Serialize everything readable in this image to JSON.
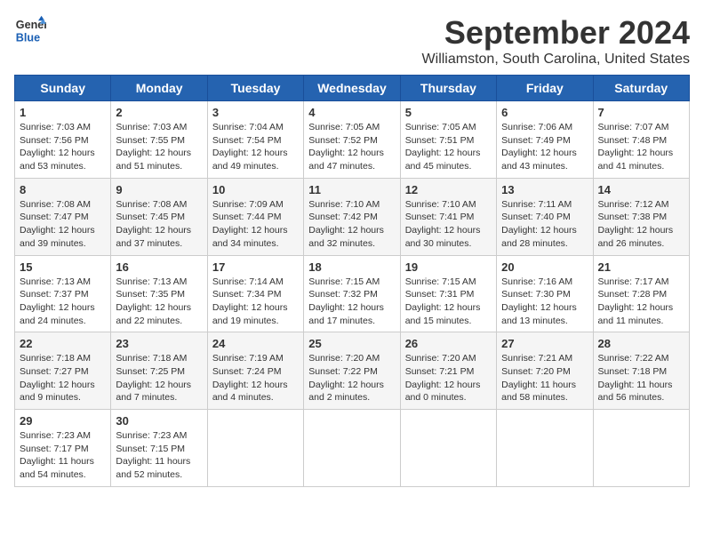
{
  "logo": {
    "line1": "General",
    "line2": "Blue"
  },
  "title": "September 2024",
  "location": "Williamston, South Carolina, United States",
  "weekdays": [
    "Sunday",
    "Monday",
    "Tuesday",
    "Wednesday",
    "Thursday",
    "Friday",
    "Saturday"
  ],
  "weeks": [
    [
      {
        "day": "1",
        "sunrise": "Sunrise: 7:03 AM",
        "sunset": "Sunset: 7:56 PM",
        "daylight": "Daylight: 12 hours and 53 minutes."
      },
      {
        "day": "2",
        "sunrise": "Sunrise: 7:03 AM",
        "sunset": "Sunset: 7:55 PM",
        "daylight": "Daylight: 12 hours and 51 minutes."
      },
      {
        "day": "3",
        "sunrise": "Sunrise: 7:04 AM",
        "sunset": "Sunset: 7:54 PM",
        "daylight": "Daylight: 12 hours and 49 minutes."
      },
      {
        "day": "4",
        "sunrise": "Sunrise: 7:05 AM",
        "sunset": "Sunset: 7:52 PM",
        "daylight": "Daylight: 12 hours and 47 minutes."
      },
      {
        "day": "5",
        "sunrise": "Sunrise: 7:05 AM",
        "sunset": "Sunset: 7:51 PM",
        "daylight": "Daylight: 12 hours and 45 minutes."
      },
      {
        "day": "6",
        "sunrise": "Sunrise: 7:06 AM",
        "sunset": "Sunset: 7:49 PM",
        "daylight": "Daylight: 12 hours and 43 minutes."
      },
      {
        "day": "7",
        "sunrise": "Sunrise: 7:07 AM",
        "sunset": "Sunset: 7:48 PM",
        "daylight": "Daylight: 12 hours and 41 minutes."
      }
    ],
    [
      {
        "day": "8",
        "sunrise": "Sunrise: 7:08 AM",
        "sunset": "Sunset: 7:47 PM",
        "daylight": "Daylight: 12 hours and 39 minutes."
      },
      {
        "day": "9",
        "sunrise": "Sunrise: 7:08 AM",
        "sunset": "Sunset: 7:45 PM",
        "daylight": "Daylight: 12 hours and 37 minutes."
      },
      {
        "day": "10",
        "sunrise": "Sunrise: 7:09 AM",
        "sunset": "Sunset: 7:44 PM",
        "daylight": "Daylight: 12 hours and 34 minutes."
      },
      {
        "day": "11",
        "sunrise": "Sunrise: 7:10 AM",
        "sunset": "Sunset: 7:42 PM",
        "daylight": "Daylight: 12 hours and 32 minutes."
      },
      {
        "day": "12",
        "sunrise": "Sunrise: 7:10 AM",
        "sunset": "Sunset: 7:41 PM",
        "daylight": "Daylight: 12 hours and 30 minutes."
      },
      {
        "day": "13",
        "sunrise": "Sunrise: 7:11 AM",
        "sunset": "Sunset: 7:40 PM",
        "daylight": "Daylight: 12 hours and 28 minutes."
      },
      {
        "day": "14",
        "sunrise": "Sunrise: 7:12 AM",
        "sunset": "Sunset: 7:38 PM",
        "daylight": "Daylight: 12 hours and 26 minutes."
      }
    ],
    [
      {
        "day": "15",
        "sunrise": "Sunrise: 7:13 AM",
        "sunset": "Sunset: 7:37 PM",
        "daylight": "Daylight: 12 hours and 24 minutes."
      },
      {
        "day": "16",
        "sunrise": "Sunrise: 7:13 AM",
        "sunset": "Sunset: 7:35 PM",
        "daylight": "Daylight: 12 hours and 22 minutes."
      },
      {
        "day": "17",
        "sunrise": "Sunrise: 7:14 AM",
        "sunset": "Sunset: 7:34 PM",
        "daylight": "Daylight: 12 hours and 19 minutes."
      },
      {
        "day": "18",
        "sunrise": "Sunrise: 7:15 AM",
        "sunset": "Sunset: 7:32 PM",
        "daylight": "Daylight: 12 hours and 17 minutes."
      },
      {
        "day": "19",
        "sunrise": "Sunrise: 7:15 AM",
        "sunset": "Sunset: 7:31 PM",
        "daylight": "Daylight: 12 hours and 15 minutes."
      },
      {
        "day": "20",
        "sunrise": "Sunrise: 7:16 AM",
        "sunset": "Sunset: 7:30 PM",
        "daylight": "Daylight: 12 hours and 13 minutes."
      },
      {
        "day": "21",
        "sunrise": "Sunrise: 7:17 AM",
        "sunset": "Sunset: 7:28 PM",
        "daylight": "Daylight: 12 hours and 11 minutes."
      }
    ],
    [
      {
        "day": "22",
        "sunrise": "Sunrise: 7:18 AM",
        "sunset": "Sunset: 7:27 PM",
        "daylight": "Daylight: 12 hours and 9 minutes."
      },
      {
        "day": "23",
        "sunrise": "Sunrise: 7:18 AM",
        "sunset": "Sunset: 7:25 PM",
        "daylight": "Daylight: 12 hours and 7 minutes."
      },
      {
        "day": "24",
        "sunrise": "Sunrise: 7:19 AM",
        "sunset": "Sunset: 7:24 PM",
        "daylight": "Daylight: 12 hours and 4 minutes."
      },
      {
        "day": "25",
        "sunrise": "Sunrise: 7:20 AM",
        "sunset": "Sunset: 7:22 PM",
        "daylight": "Daylight: 12 hours and 2 minutes."
      },
      {
        "day": "26",
        "sunrise": "Sunrise: 7:20 AM",
        "sunset": "Sunset: 7:21 PM",
        "daylight": "Daylight: 12 hours and 0 minutes."
      },
      {
        "day": "27",
        "sunrise": "Sunrise: 7:21 AM",
        "sunset": "Sunset: 7:20 PM",
        "daylight": "Daylight: 11 hours and 58 minutes."
      },
      {
        "day": "28",
        "sunrise": "Sunrise: 7:22 AM",
        "sunset": "Sunset: 7:18 PM",
        "daylight": "Daylight: 11 hours and 56 minutes."
      }
    ],
    [
      {
        "day": "29",
        "sunrise": "Sunrise: 7:23 AM",
        "sunset": "Sunset: 7:17 PM",
        "daylight": "Daylight: 11 hours and 54 minutes."
      },
      {
        "day": "30",
        "sunrise": "Sunrise: 7:23 AM",
        "sunset": "Sunset: 7:15 PM",
        "daylight": "Daylight: 11 hours and 52 minutes."
      },
      null,
      null,
      null,
      null,
      null
    ]
  ]
}
